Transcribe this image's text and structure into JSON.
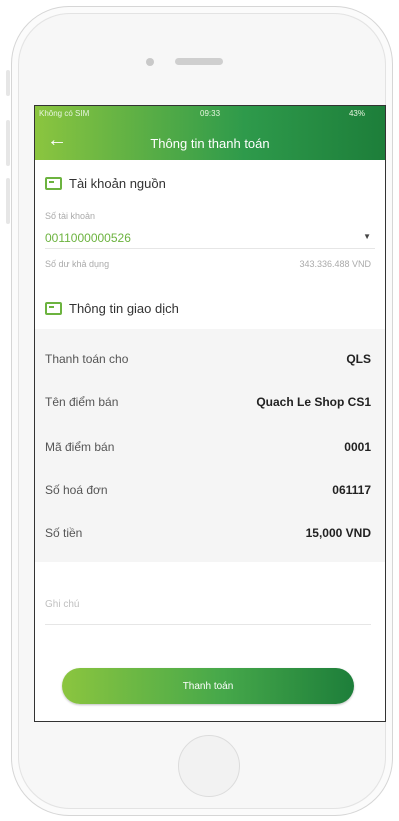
{
  "status_bar": {
    "carrier": "Không có SIM",
    "time": "09:33",
    "battery": "43%"
  },
  "header": {
    "title": "Thông tin thanh toán"
  },
  "source_account": {
    "section_title": "Tài khoản nguồn",
    "account_label": "Số tài khoản",
    "account_number": "0011000000526",
    "balance_label": "Số dư khả dụng",
    "balance_value": "343.336.488 VND"
  },
  "transaction_info": {
    "section_title": "Thông tin giao dịch",
    "rows": [
      {
        "label": "Thanh toán cho",
        "value": "QLS"
      },
      {
        "label": "Tên điểm bán",
        "value": "Quach Le Shop CS1"
      },
      {
        "label": "Mã điểm bán",
        "value": "0001"
      },
      {
        "label": "Số hoá đơn",
        "value": "061117"
      },
      {
        "label": "Số tiền",
        "value": "15,000 VND"
      }
    ]
  },
  "note": {
    "placeholder": "Ghi chú"
  },
  "actions": {
    "pay_label": "Thanh toán"
  },
  "colors": {
    "accent_green": "#6cb33f",
    "header_dark": "#1d7e3a"
  }
}
